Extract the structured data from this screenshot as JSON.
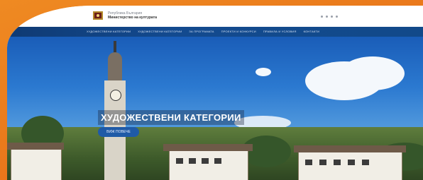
{
  "colors": {
    "background_orange": "#f07f1e",
    "navbar_blue": "#134a8f",
    "button_blue": "#1f5aa7",
    "hero_text": "#ffffff"
  },
  "header": {
    "logo_icon": "coat-of-arms-icon",
    "org_line1": "Република България",
    "org_line2": "Министерство на културата",
    "top_icons": [
      "social-icon",
      "social-icon",
      "social-icon",
      "social-icon"
    ]
  },
  "nav": {
    "items": [
      "ХУДОЖЕСТВЕНИ КАТЕГОРИИ",
      "ХУДОЖЕСТВЕНИ КАТЕГОРИИ",
      "ЗА ПРОГРАМАТА",
      "ПРОЕКТИ И КОНКУРСИ",
      "ПРАВИЛА И УСЛОВИЯ",
      "КОНТАКТИ"
    ]
  },
  "hero": {
    "title": "ХУДОЖЕСТВЕНИ КАТЕГОРИИ",
    "button_label": "ВИЖ ПОВЕЧЕ"
  }
}
